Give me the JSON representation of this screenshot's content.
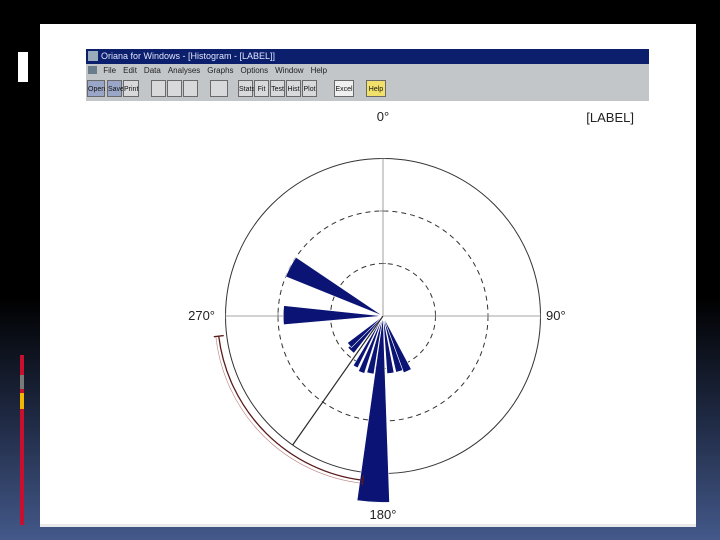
{
  "window": {
    "title": "Oriana for Windows - [Histogram - [LABEL]]",
    "menu": [
      "File",
      "Edit",
      "Data",
      "Analyses",
      "Graphs",
      "Options",
      "Window",
      "Help"
    ],
    "toolbar_buttons": [
      {
        "label": "Open",
        "icon": "open-icon"
      },
      {
        "label": "Save",
        "icon": "save-icon"
      },
      {
        "label": "Print",
        "icon": "print-icon"
      },
      {
        "label": "",
        "icon": "cut-icon"
      },
      {
        "label": "",
        "icon": "copy-icon"
      },
      {
        "label": "",
        "icon": "paste-icon"
      },
      {
        "label": "",
        "icon": "data-icon"
      },
      {
        "label": "Stats",
        "icon": "sum-icon"
      },
      {
        "label": "Fit",
        "icon": "fit-icon"
      },
      {
        "label": "Test",
        "icon": "test-icon"
      },
      {
        "label": "Hist",
        "icon": "histogram-icon"
      },
      {
        "label": "Plot",
        "icon": "plot-icon"
      },
      {
        "label": "Excel",
        "icon": "excel-icon"
      },
      {
        "label": "Help",
        "icon": "help-icon"
      }
    ]
  },
  "chart_label": "[LABEL]",
  "chart_data": {
    "type": "rose",
    "radial_rings": 3,
    "compass_labels": [
      "0°",
      "90°",
      "180°",
      "270°"
    ],
    "petals": [
      {
        "start_deg": 178,
        "end_deg": 188,
        "length_ring": 3.55
      },
      {
        "start_deg": 152,
        "end_deg": 160,
        "length_ring": 1.15
      },
      {
        "start_deg": 160,
        "end_deg": 167,
        "length_ring": 1.1
      },
      {
        "start_deg": 169,
        "end_deg": 176,
        "length_ring": 1.1
      },
      {
        "start_deg": 189,
        "end_deg": 196,
        "length_ring": 1.12
      },
      {
        "start_deg": 198,
        "end_deg": 204,
        "length_ring": 1.15
      },
      {
        "start_deg": 206,
        "end_deg": 211,
        "length_ring": 1.1
      },
      {
        "start_deg": 218,
        "end_deg": 228,
        "length_ring": 0.9
      },
      {
        "start_deg": 225,
        "end_deg": 233,
        "length_ring": 0.85
      },
      {
        "start_deg": 265,
        "end_deg": 276,
        "length_ring": 1.9
      },
      {
        "start_deg": 292,
        "end_deg": 304,
        "length_ring": 2.0
      }
    ],
    "mean_vector_deg": 215,
    "confidence_arc_deg": [
      187,
      263
    ],
    "colors": {
      "petal": "#0b1475",
      "ring": "#333333"
    }
  }
}
